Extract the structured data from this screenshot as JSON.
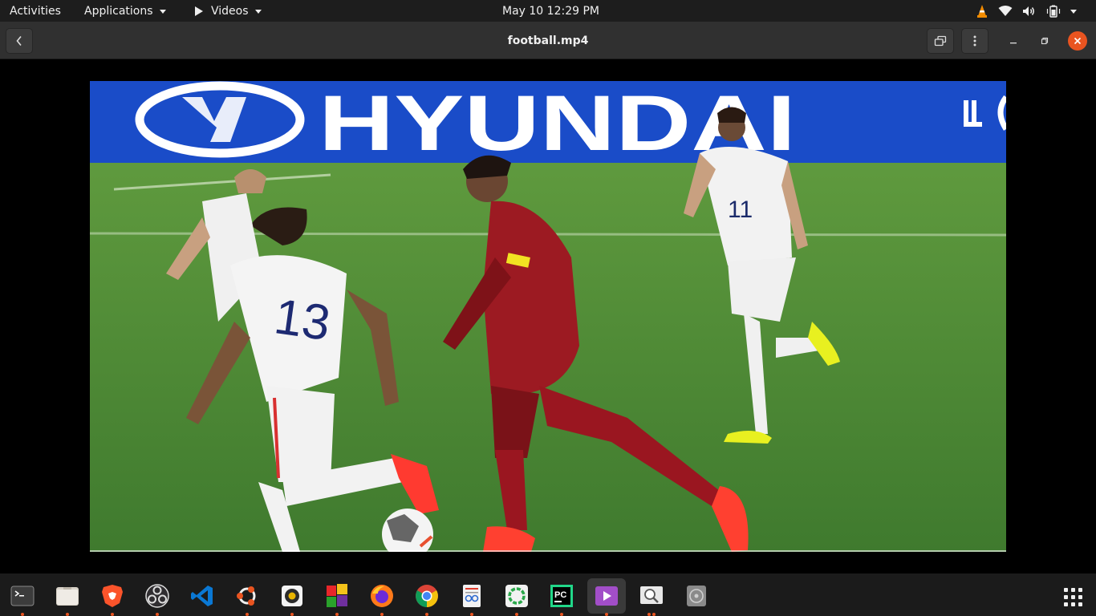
{
  "topbar": {
    "activities": "Activities",
    "applications": "Applications",
    "videos": "Videos",
    "clock": "May 10  12:29 PM",
    "tray_icons": [
      "vlc-icon",
      "wifi-icon",
      "volume-icon",
      "battery-icon",
      "power-menu-icon"
    ]
  },
  "window": {
    "title": "football.mp4",
    "back_icon": "chevron-left-icon",
    "buttons": [
      "popout-icon",
      "kebab-menu-icon",
      "minimize-icon",
      "maximize-icon",
      "close-icon"
    ],
    "close_color": "#e95420"
  },
  "video": {
    "banner_text": "HYUNDAI",
    "jersey_number": "13"
  },
  "dock": {
    "items": [
      {
        "name": "terminal",
        "running": true
      },
      {
        "name": "files",
        "running": true
      },
      {
        "name": "brave-browser",
        "running": true
      },
      {
        "name": "obs-studio",
        "running": true
      },
      {
        "name": "vscode",
        "running": false
      },
      {
        "name": "ubuntu-software",
        "running": true
      },
      {
        "name": "rhythmbox",
        "running": true
      },
      {
        "name": "libreoffice-calc-colorful",
        "running": true
      },
      {
        "name": "firefox",
        "running": true
      },
      {
        "name": "chrome",
        "running": true
      },
      {
        "name": "document-viewer",
        "running": true
      },
      {
        "name": "circle-app",
        "running": true
      },
      {
        "name": "pycharm",
        "running": true
      },
      {
        "name": "videos",
        "running": true,
        "active": true
      },
      {
        "name": "image-viewer",
        "running": true
      },
      {
        "name": "disk-utility",
        "running": false
      }
    ],
    "pycharm_label": "PC",
    "show_apps_icon": "grid-icon"
  },
  "colors": {
    "accent": "#e95420",
    "topbar": "#1d1d1d",
    "headerbar": "#303030",
    "dock": "#1b1b1b"
  }
}
